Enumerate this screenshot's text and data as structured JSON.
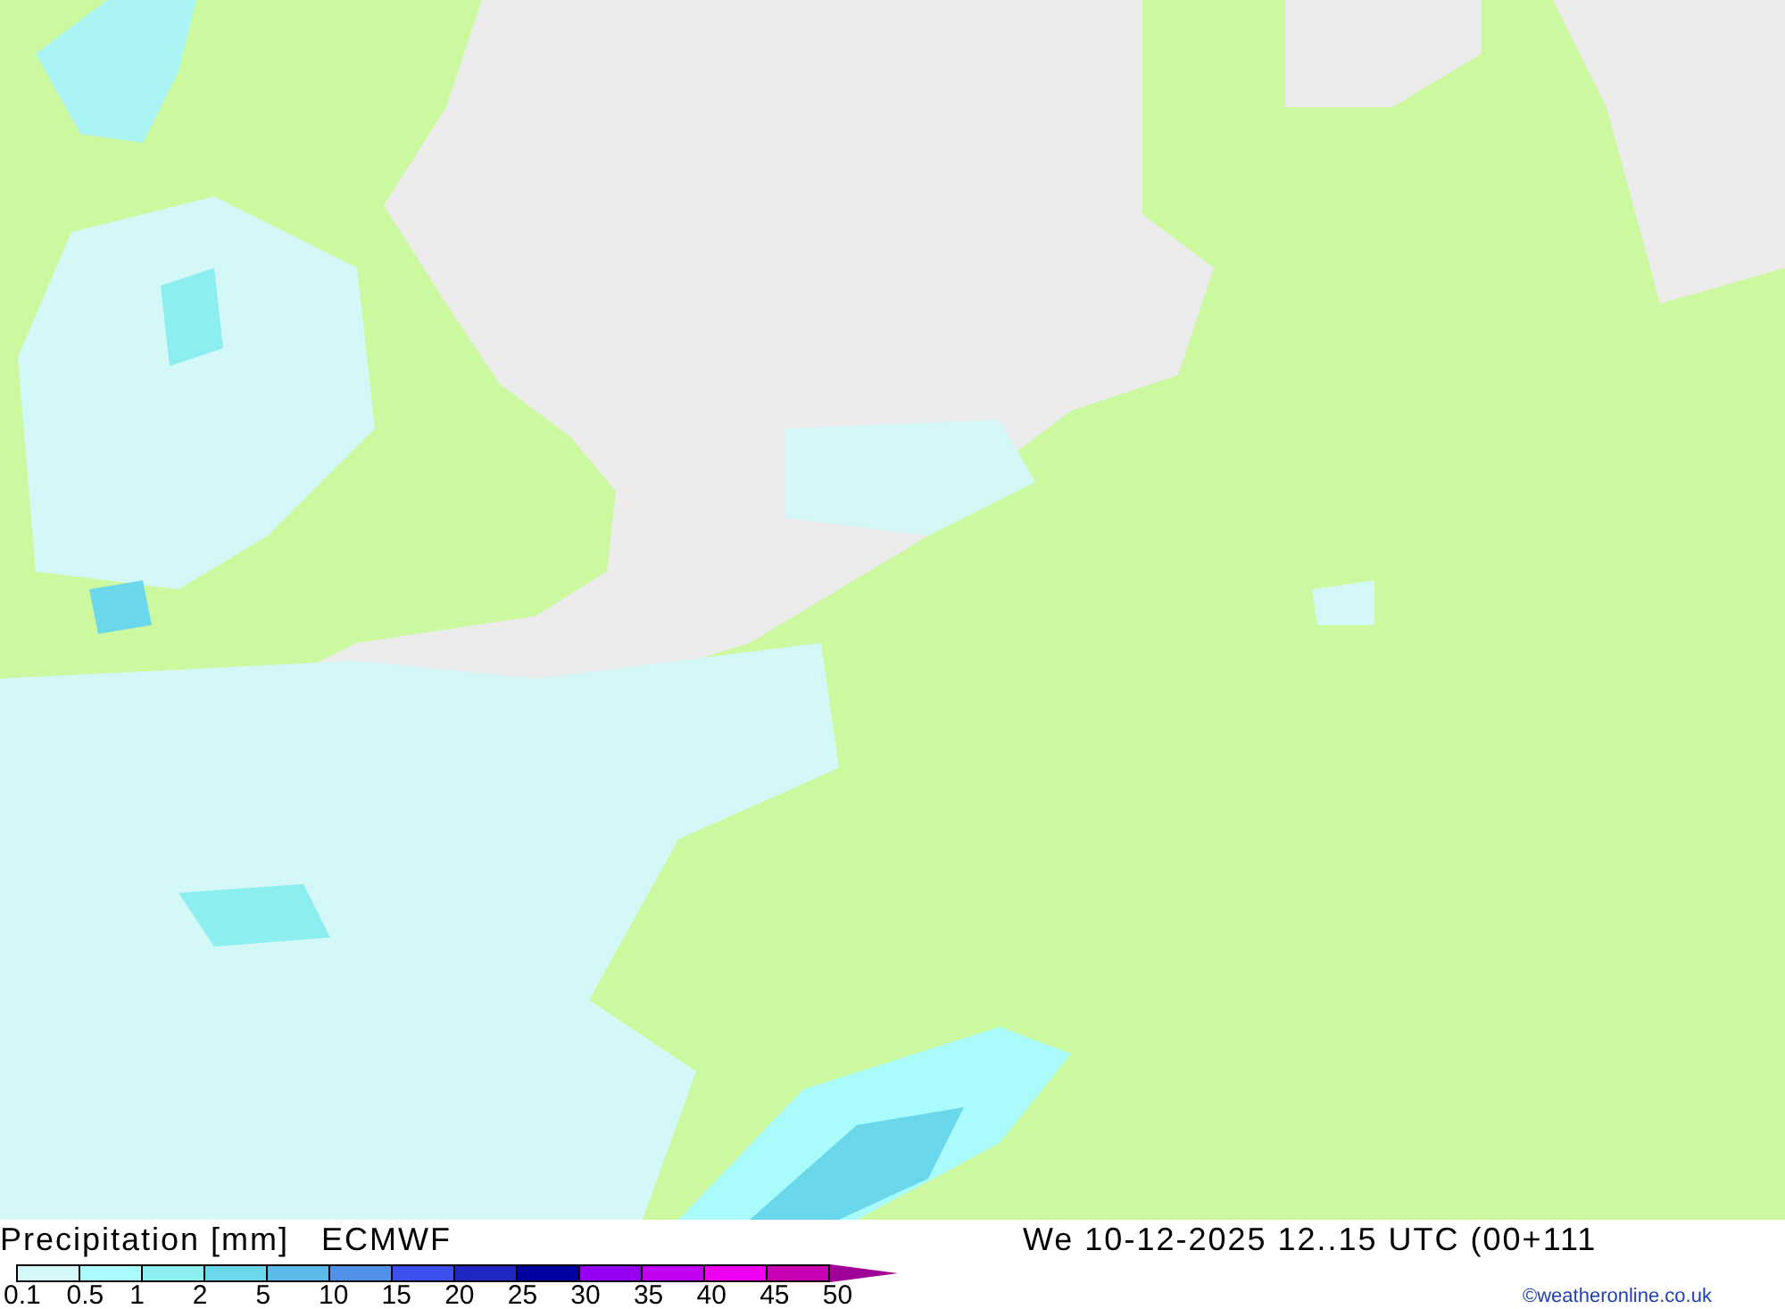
{
  "legend": {
    "title": "Precipitation [mm]",
    "model": "ECMWF",
    "swatches": [
      {
        "kind": "box",
        "color": "#d4f8f8"
      },
      {
        "kind": "box",
        "color": "#aafcfc"
      },
      {
        "kind": "box",
        "color": "#8ceeee"
      },
      {
        "kind": "box",
        "color": "#6ad8ea"
      },
      {
        "kind": "box",
        "color": "#5abbe8"
      },
      {
        "kind": "box",
        "color": "#5090e8"
      },
      {
        "kind": "box",
        "color": "#3c50f0"
      },
      {
        "kind": "box",
        "color": "#1e28c0"
      },
      {
        "kind": "box",
        "color": "#0000a0"
      },
      {
        "kind": "box",
        "color": "#9600f0"
      },
      {
        "kind": "box",
        "color": "#c000f0"
      },
      {
        "kind": "box",
        "color": "#f000f0"
      },
      {
        "kind": "box",
        "color": "#c800b4"
      },
      {
        "kind": "arrow",
        "color": "#a00096"
      }
    ],
    "labels": [
      "0.1",
      "0.5",
      "1",
      "2",
      "5",
      "10",
      "15",
      "20",
      "25",
      "30",
      "35",
      "40",
      "45",
      "50"
    ]
  },
  "valid_time": "We 10-12-2025 12..15 UTC (00+111",
  "credit": "©weatheronline.co.uk"
}
